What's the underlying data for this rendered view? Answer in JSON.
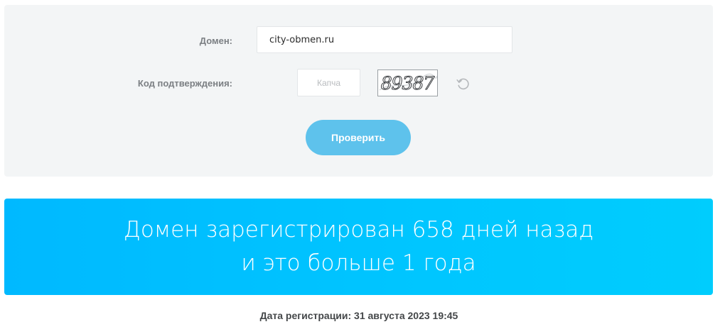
{
  "form": {
    "domain_label": "Домен:",
    "domain_value": "city-obmen.ru",
    "code_label": "Код подтверждения:",
    "captcha_placeholder": "Капча",
    "captcha_text": "89387",
    "refresh_icon": "refresh-icon",
    "submit_label": "Проверить"
  },
  "result": {
    "line1": "Домен зарегистрирован 658 дней назад",
    "line2": "и это больше 1 года"
  },
  "registration": {
    "text": "Дата регистрации: 31 августа 2023 19:45"
  },
  "colors": {
    "panel_bg": "#f3f5f6",
    "button": "#5ec2ec",
    "banner": "#00c3ff"
  }
}
